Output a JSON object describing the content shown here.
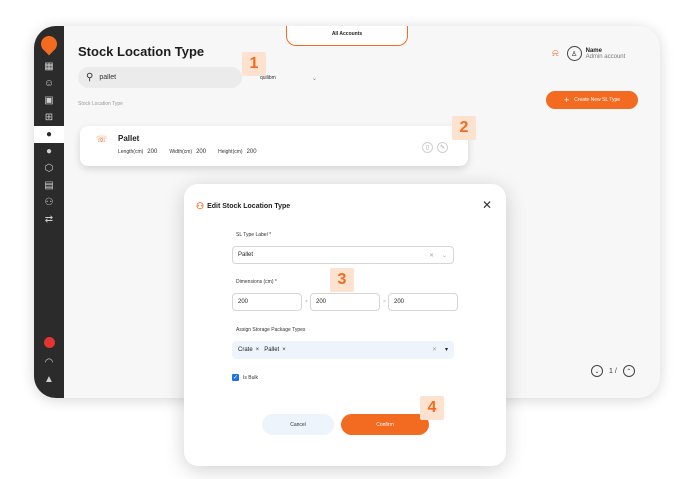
{
  "app": {
    "title": "Stock Location Type",
    "accounts_tab": "All Accounts",
    "user": {
      "name": "Name",
      "role": "Admin account"
    },
    "colors": {
      "accent": "#f26b21",
      "sidebar": "#2b2b2b",
      "checkbox": "#1e73e8"
    }
  },
  "sidebar": {
    "items": [
      {
        "icon": "dashboard-icon",
        "glyph": "▦"
      },
      {
        "icon": "robot-icon",
        "glyph": "☺"
      },
      {
        "icon": "box-icon",
        "glyph": "▣"
      },
      {
        "icon": "grid-icon",
        "glyph": "⊞"
      },
      {
        "icon": "location-icon",
        "glyph": "●",
        "active": true
      },
      {
        "icon": "dot-icon",
        "glyph": "●"
      },
      {
        "icon": "cube-icon",
        "glyph": "⬡"
      },
      {
        "icon": "clipboard-icon",
        "glyph": "▤"
      },
      {
        "icon": "hierarchy-icon",
        "glyph": "⚇"
      },
      {
        "icon": "transfer-icon",
        "glyph": "⇄"
      }
    ],
    "bottom": [
      {
        "icon": "headset-icon",
        "glyph": "🎧"
      },
      {
        "icon": "bell-icon",
        "glyph": "🔔"
      }
    ]
  },
  "search": {
    "value": "pallet",
    "placeholder": ""
  },
  "filter": {
    "value": "quilibm"
  },
  "breadcrumb": "Stock Location Type",
  "create_button": "Create New SL Type",
  "card": {
    "name": "Pallet",
    "length_label": "Length(cm)",
    "length": "200",
    "width_label": "Width(cm)",
    "width": "200",
    "height_label": "Height(cm)",
    "height": "200"
  },
  "pagination": {
    "page": "1 /"
  },
  "badges": [
    "1",
    "2",
    "3",
    "4"
  ],
  "modal": {
    "title": "Edit Stock Location Type",
    "sl_label": "SL Type Label *",
    "sl_value": "Pallet",
    "dims_label": "Dimensions (cm) *",
    "dim_values": [
      "200",
      "200",
      "200"
    ],
    "storage_label": "Assign Storage Package Types",
    "storage_tags": [
      "Crate",
      "Pallet"
    ],
    "is_bulk": true,
    "is_bulk_label": "Is Bulk",
    "cancel": "Cancel",
    "confirm": "Confirm"
  }
}
